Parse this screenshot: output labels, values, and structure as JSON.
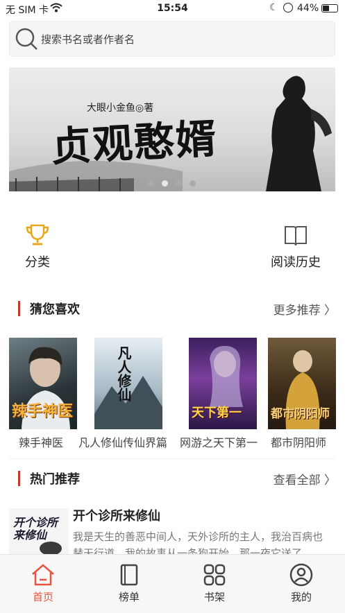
{
  "status": {
    "carrier": "无 SIM 卡",
    "time": "15:54",
    "battery": "44%",
    "battery_level": 0.44
  },
  "search": {
    "placeholder": "搜索书名或者作者名"
  },
  "banner": {
    "author": "大眼小金鱼◎著",
    "title": "贞观憨婿",
    "dots": 4,
    "active_dot": 1
  },
  "quick_nav": [
    {
      "label": "分类",
      "icon": "trophy-icon"
    },
    {
      "label": "阅读历史",
      "icon": "book-open-icon"
    }
  ],
  "guess": {
    "title": "猜您喜欢",
    "more": "更多推荐",
    "books": [
      {
        "label": "辣手神医",
        "cover_text": "辣手神医"
      },
      {
        "label": "凡人修仙传仙界篇",
        "cover_text": "凡人修仙"
      },
      {
        "label": "网游之天下第一",
        "cover_text": "天下第一"
      },
      {
        "label": "都市阴阳师",
        "cover_text": "都市阴阳师"
      }
    ]
  },
  "hot": {
    "title": "热门推荐",
    "more": "查看全部",
    "item": {
      "title": "开个诊所来修仙",
      "cover_text": "开个诊所来修仙",
      "desc": "我是天生的善恶中间人，天外诊所的主人，我治百病也替天行道。我的故事从一条狗开始，那一夜它送了"
    }
  },
  "tabs": [
    {
      "label": "首页",
      "icon": "home-icon",
      "active": true
    },
    {
      "label": "榜单",
      "icon": "ranking-icon",
      "active": false
    },
    {
      "label": "书架",
      "icon": "bookshelf-icon",
      "active": false
    },
    {
      "label": "我的",
      "icon": "profile-icon",
      "active": false
    }
  ],
  "colors": {
    "accent": "#e8533f",
    "section_bar": "#c0392b",
    "trophy": "#e6a817"
  }
}
